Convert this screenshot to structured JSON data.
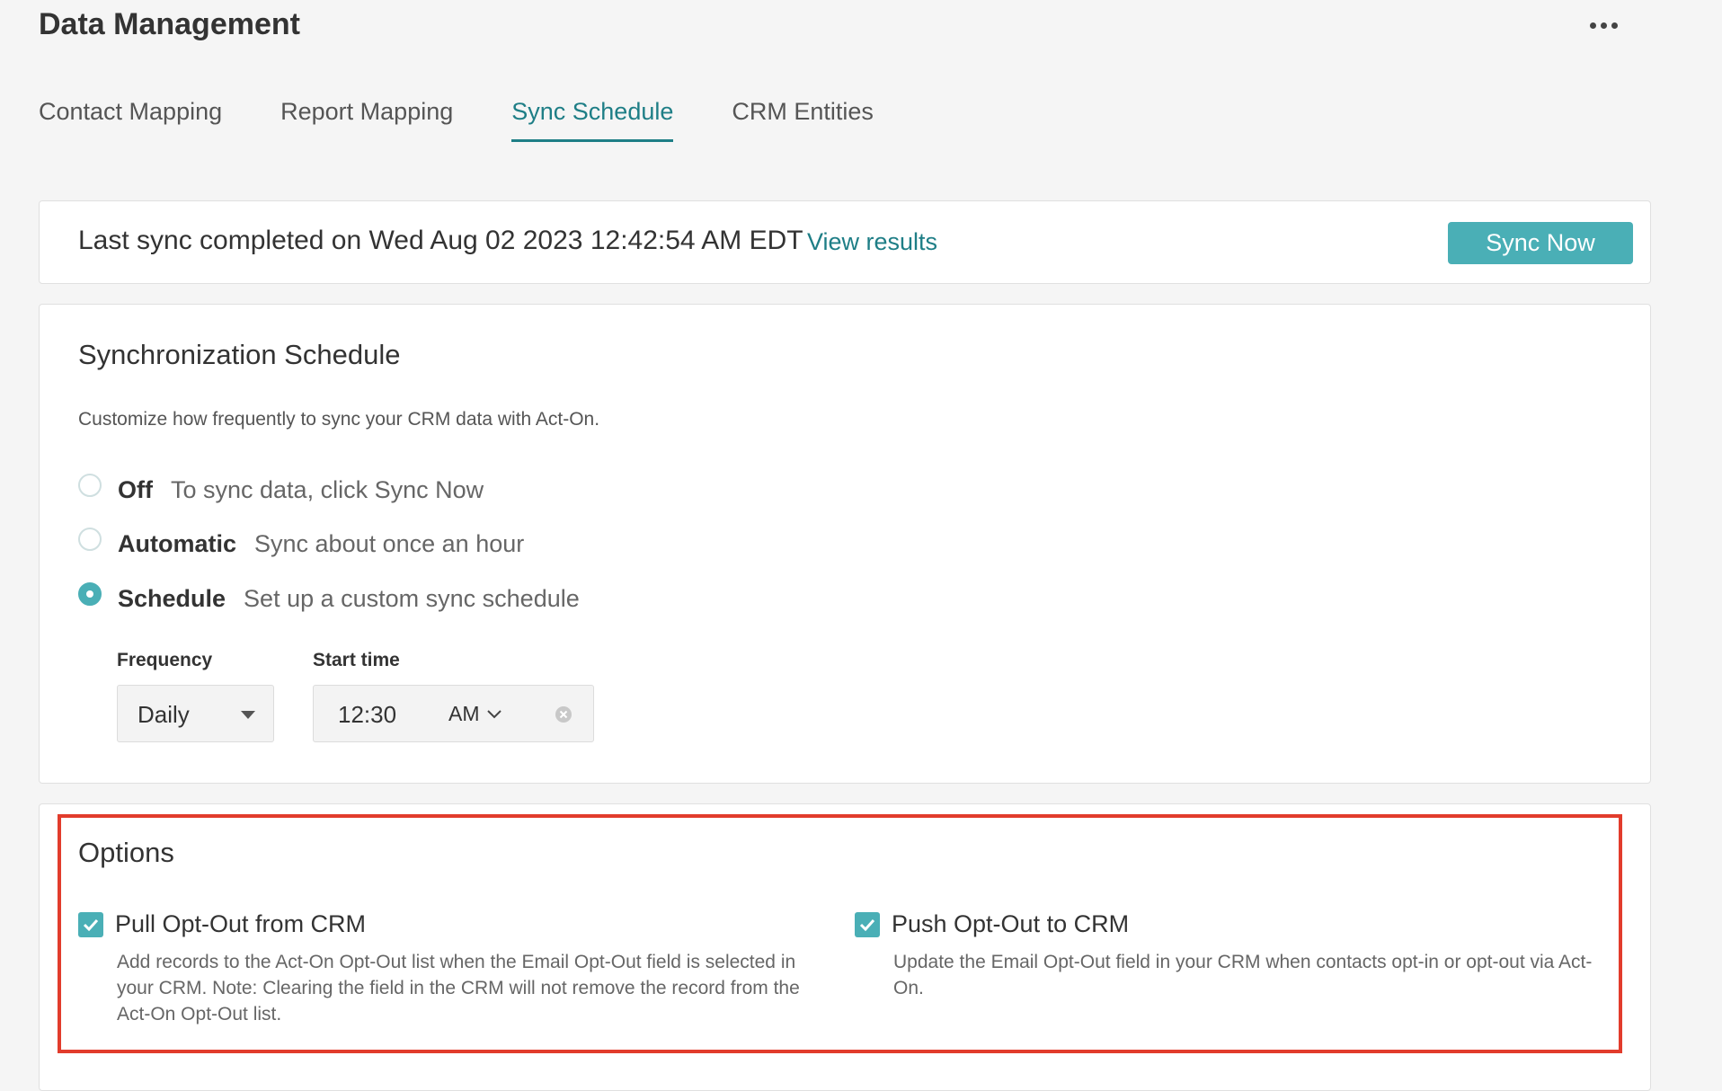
{
  "header": {
    "title": "Data Management",
    "more_icon": "more-horizontal-icon"
  },
  "tabs": [
    {
      "label": "Contact Mapping",
      "active": false
    },
    {
      "label": "Report Mapping",
      "active": false
    },
    {
      "label": "Sync Schedule",
      "active": true
    },
    {
      "label": "CRM Entities",
      "active": false
    }
  ],
  "sync_status": {
    "text": "Last sync completed on Wed Aug 02 2023 12:42:54 AM EDT",
    "view_results": "View results",
    "sync_button": "Sync Now"
  },
  "schedule": {
    "title": "Synchronization Schedule",
    "description": "Customize how frequently to sync your CRM data with Act-On.",
    "radio_options": [
      {
        "label": "Off",
        "description": "To sync data, click Sync Now",
        "selected": false
      },
      {
        "label": "Automatic",
        "description": "Sync about once an hour",
        "selected": false
      },
      {
        "label": "Schedule",
        "description": "Set up a custom sync schedule",
        "selected": true
      }
    ],
    "frequency": {
      "label": "Frequency",
      "value": "Daily"
    },
    "start_time": {
      "label": "Start time",
      "time": "12:30",
      "period": "AM"
    }
  },
  "options": {
    "title": "Options",
    "pull": {
      "label": "Pull Opt-Out from CRM",
      "checked": true,
      "description": "Add records to the Act-On Opt-Out list when the Email Opt-Out field is selected in your CRM. Note: Clearing the field in the CRM will not remove the record from the Act-On Opt-Out list."
    },
    "push": {
      "label": "Push Opt-Out to CRM",
      "checked": true,
      "description": "Update the Email Opt-Out field in your CRM when contacts opt-in or opt-out via Act-On."
    }
  },
  "colors": {
    "accent": "#1e7e86",
    "button": "#4aafb6",
    "highlight": "#e23c2c"
  }
}
